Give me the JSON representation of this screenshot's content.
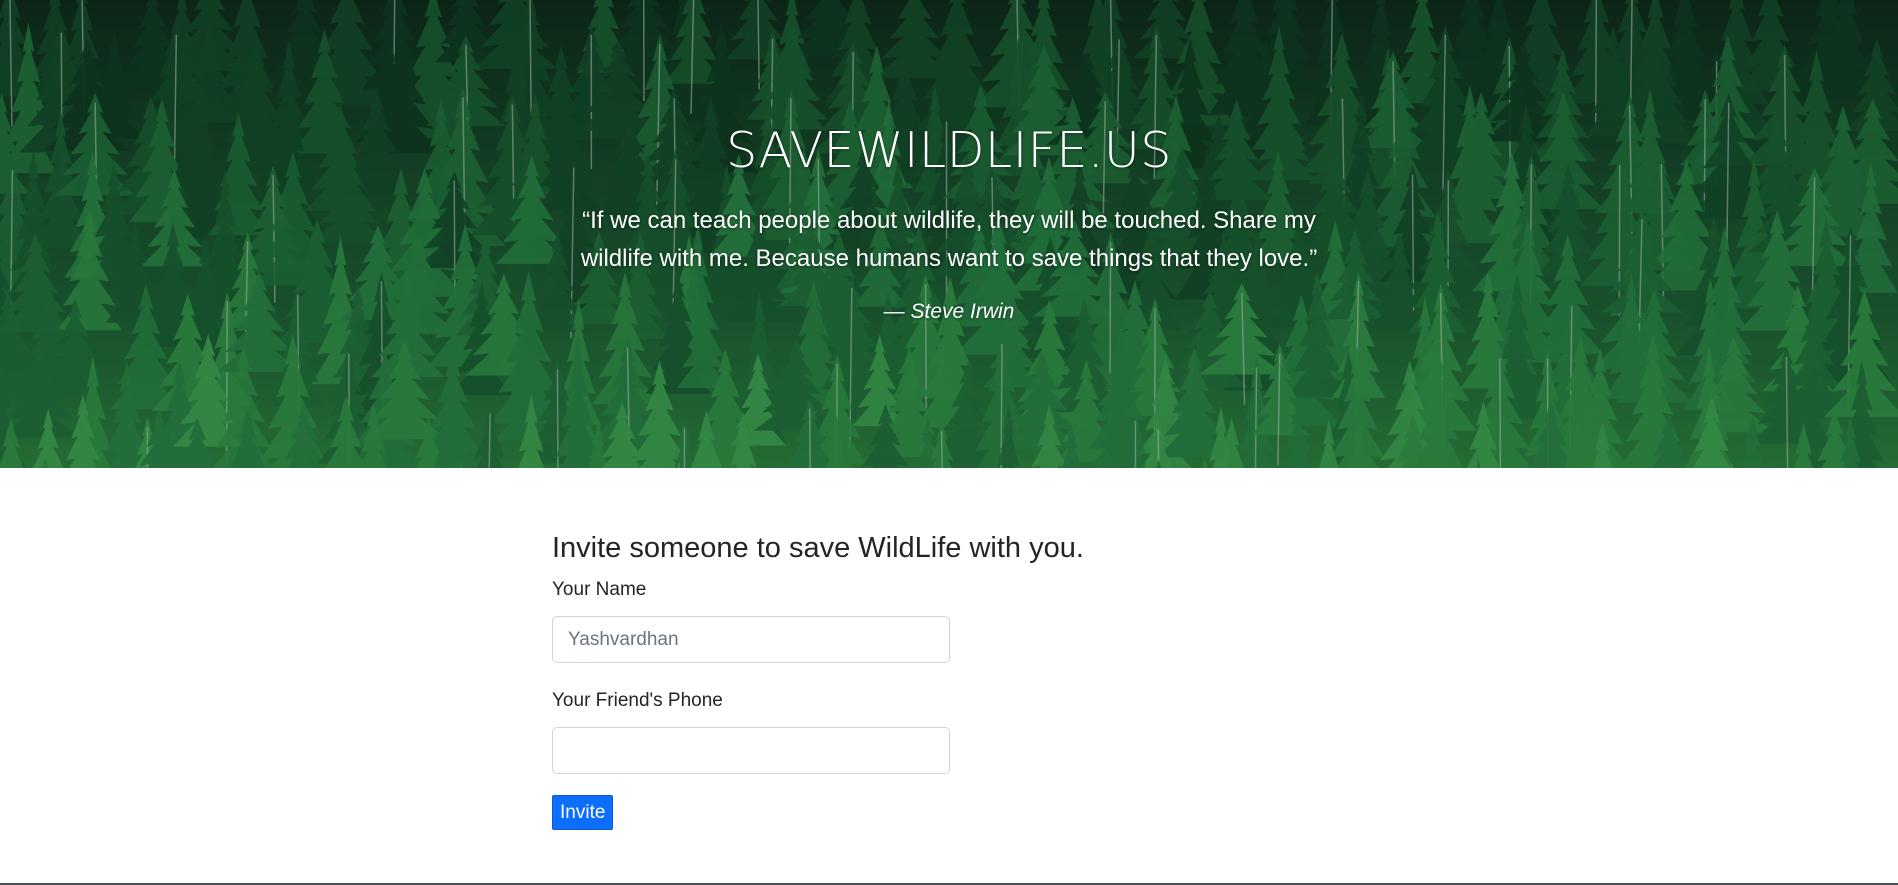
{
  "hero": {
    "site_title": "SAVEWILDLIFE.US",
    "quote": "“If we can teach people about wildlife, they will be touched. Share my wildlife with me. Because humans want to save things that they love.”",
    "author": "— Steve Irwin"
  },
  "invite_form": {
    "heading": "Invite someone to save WildLife with you.",
    "name_label": "Your Name",
    "name_placeholder": "Yashvardhan",
    "phone_label": "Your Friend's Phone",
    "phone_value": "",
    "submit_label": "Invite"
  },
  "colors": {
    "accent": "#0d6efd",
    "forest_dark": "#0e2a1a",
    "forest_light": "#2f8a45"
  }
}
